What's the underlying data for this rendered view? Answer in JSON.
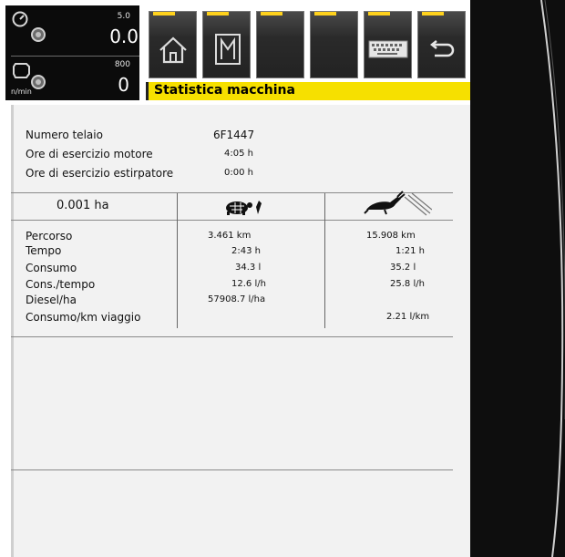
{
  "gauges": {
    "speed_max": "5.0",
    "speed_value": "0.0",
    "rpm_max": "800",
    "rpm_value": "0",
    "rpm_unit": "n/min",
    "speed_icon": "speedometer-icon",
    "engine_icon": "engine-icon"
  },
  "softkeys": [
    {
      "icon": "home-icon"
    },
    {
      "icon": "memory-icon"
    },
    {
      "icon": ""
    },
    {
      "icon": ""
    },
    {
      "icon": "keyboard-icon"
    },
    {
      "icon": "back-icon"
    }
  ],
  "title": "Statistica macchina",
  "info": [
    {
      "label": "Numero telaio",
      "value": "6F1447"
    },
    {
      "label": "Ore di esercizio motore",
      "value": "4:05 h"
    },
    {
      "label": "Ore di esercizio estirpatore",
      "value": "0:00 h"
    }
  ],
  "table": {
    "area": "0.001 ha",
    "col_work_icon": "turtle-work-icon",
    "col_road_icon": "rabbit-road-icon",
    "rows": [
      {
        "label": "Percorso",
        "work": "3.461 km",
        "road": "15.908 km"
      },
      {
        "label": "Tempo",
        "work": "2:43 h",
        "road": "1:21 h"
      },
      {
        "label": "Consumo",
        "work": "34.3 l",
        "road": "35.2 l"
      },
      {
        "label": "Cons./tempo",
        "work": "12.6 l/h",
        "road": "25.8 l/h"
      },
      {
        "label": "Diesel/ha",
        "work": "57908.7 l/ha",
        "road": ""
      },
      {
        "label": "Consumo/km viaggio",
        "work": "",
        "road": "2.21 l/km"
      }
    ]
  },
  "colors": {
    "title_bar": "#f6e000",
    "softkey_tick": "#ffd21c",
    "panel_bg": "#f2f2f2"
  }
}
